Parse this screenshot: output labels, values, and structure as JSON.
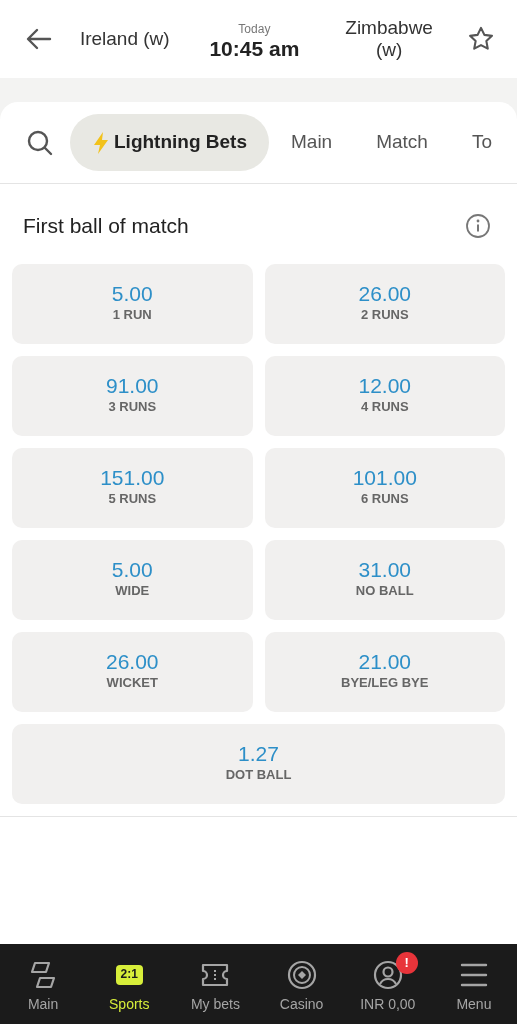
{
  "header": {
    "team_home": "Ireland (w)",
    "date_label": "Today",
    "time": "10:45 am",
    "team_away": "Zimbabwe (w)"
  },
  "tabs": [
    {
      "label": "Lightning Bets",
      "kind": "lightning",
      "selected": true
    },
    {
      "label": "Main",
      "kind": "plain",
      "selected": false
    },
    {
      "label": "Match",
      "kind": "plain",
      "selected": false
    },
    {
      "label": "To",
      "kind": "plain",
      "selected": false
    }
  ],
  "market": {
    "title": "First ball of match",
    "outcomes": [
      {
        "odds": "5.00",
        "label": "1 RUN"
      },
      {
        "odds": "26.00",
        "label": "2 RUNS"
      },
      {
        "odds": "91.00",
        "label": "3 RUNS"
      },
      {
        "odds": "12.00",
        "label": "4 RUNS"
      },
      {
        "odds": "151.00",
        "label": "5 RUNS"
      },
      {
        "odds": "101.00",
        "label": "6 RUNS"
      },
      {
        "odds": "5.00",
        "label": "WIDE"
      },
      {
        "odds": "31.00",
        "label": "NO BALL"
      },
      {
        "odds": "26.00",
        "label": "WICKET"
      },
      {
        "odds": "21.00",
        "label": "BYE/LEG BYE"
      },
      {
        "odds": "1.27",
        "label": "DOT BALL"
      }
    ]
  },
  "bottom_nav": [
    {
      "label": "Main",
      "kind": "main",
      "selected": false
    },
    {
      "label": "Sports",
      "kind": "sports",
      "icon_text": "2:1",
      "selected": true
    },
    {
      "label": "My bets",
      "kind": "ticket",
      "selected": false
    },
    {
      "label": "Casino",
      "kind": "chip",
      "selected": false
    },
    {
      "label": "INR 0,00",
      "kind": "account",
      "badge": "!",
      "selected": false
    },
    {
      "label": "Menu",
      "kind": "menu",
      "selected": false
    }
  ]
}
